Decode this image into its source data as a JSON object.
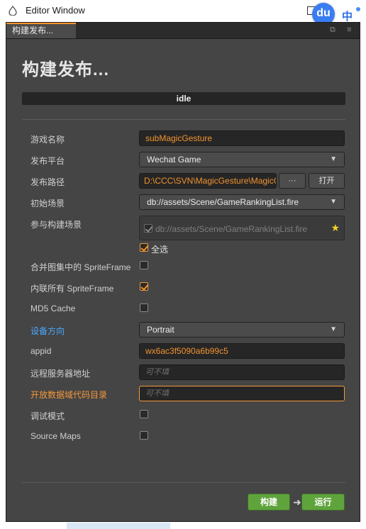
{
  "os_window": {
    "title": "Editor Window",
    "ime": {
      "badge": "du",
      "mode": "中"
    }
  },
  "tab": {
    "label": "构建发布...",
    "icons": [
      "restore-window-icon",
      "menu-icon"
    ]
  },
  "panel": {
    "title": "构建发布...",
    "status": "idle"
  },
  "form": {
    "game_name": {
      "label": "游戏名称",
      "value": "subMagicGesture"
    },
    "platform": {
      "label": "发布平台",
      "value": "Wechat Game"
    },
    "path": {
      "label": "发布路径",
      "value": "D:\\CCC\\SVN\\MagicGesture\\MagicGest",
      "browse_label": "···",
      "open_label": "打开"
    },
    "start_scene": {
      "label": "初始场景",
      "value": "db://assets/Scene/GameRankingList.fire"
    },
    "scenes": {
      "label": "参与构建场景",
      "items": [
        {
          "path": "db://assets/Scene/GameRankingList.fire",
          "checked": true
        }
      ],
      "select_all_label": "全选",
      "select_all_checked": true
    },
    "merge_sprite": {
      "label": "合并图集中的 SpriteFrame",
      "checked": false
    },
    "inline_sprite": {
      "label": "内联所有 SpriteFrame",
      "checked": true
    },
    "md5": {
      "label": "MD5 Cache",
      "checked": false
    },
    "orientation": {
      "label": "设备方向",
      "value": "Portrait"
    },
    "appid": {
      "label": "appid",
      "value": "wx6ac3f5090a6b99c5"
    },
    "remote_server": {
      "label": "远程服务器地址",
      "placeholder": "可不填"
    },
    "open_data_dir": {
      "label": "开放数据域代码目录",
      "placeholder": "可不填"
    },
    "debug": {
      "label": "调试模式",
      "checked": false
    },
    "source_maps": {
      "label": "Source Maps",
      "checked": false
    }
  },
  "actions": {
    "build_label": "构建",
    "run_label": "运行"
  },
  "colors": {
    "accent_orange": "#fd942b",
    "link_blue": "#4aa9ff",
    "button_green": "#5fa33d"
  }
}
